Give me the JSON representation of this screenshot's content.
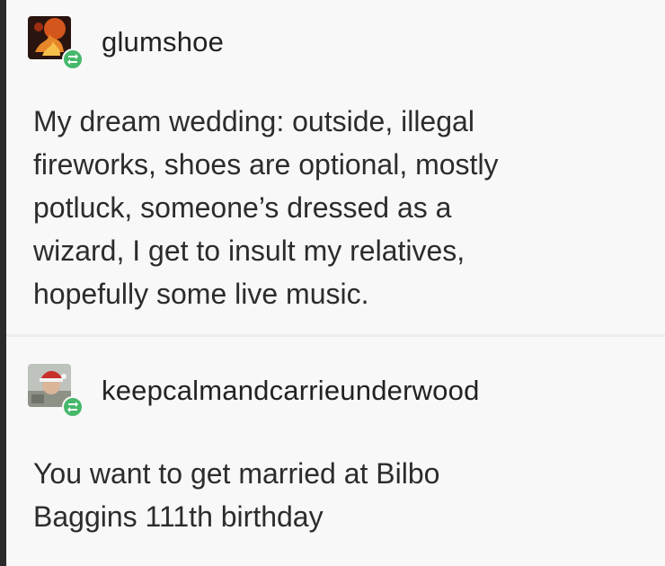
{
  "posts": [
    {
      "username": "glumshoe",
      "avatar_icon": "fire-emblem-avatar-icon",
      "badge_icon": "reblog-icon",
      "body_lines": [
        "My dream wedding: outside, illegal",
        "fireworks, shoes are optional, mostly",
        "potluck, someone’s dressed as a",
        "wizard, I get to insult my relatives,",
        "hopefully some live music."
      ]
    },
    {
      "username": "keepcalmandcarrieunderwood",
      "avatar_icon": "santa-hat-person-avatar-icon",
      "badge_icon": "reblog-icon",
      "body_lines": [
        "You want to get married at Bilbo",
        "Baggins 111th birthday"
      ]
    }
  ],
  "colors": {
    "badge": "#45b86a",
    "text": "#2c2c2c",
    "background": "#f8f8f8"
  }
}
